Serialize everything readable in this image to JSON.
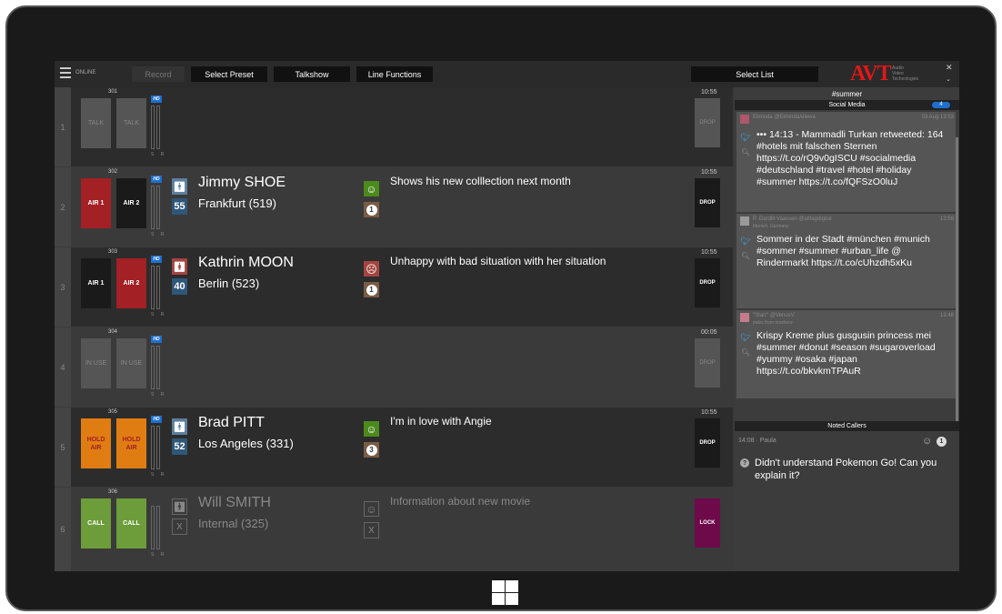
{
  "topbar": {
    "status": "ONLINE",
    "record": "Record",
    "buttons": [
      "Select Preset",
      "Talkshow",
      "Line Functions"
    ],
    "select_list": "Select List",
    "brand": "AVT",
    "brand_sub": [
      "Audio",
      "Video",
      "Technologies"
    ]
  },
  "lines": [
    {
      "num": "1",
      "ext": "301",
      "time": "10:55",
      "b1": "TALK",
      "b2": "TALK",
      "drop": "DROP"
    },
    {
      "num": "2",
      "ext": "302",
      "time": "10:55",
      "b1": "AIR 1",
      "b2": "AIR 2",
      "name": "Jimmy SHOE",
      "city": "Frankfurt (519)",
      "age": "55",
      "topic": "Shows his new colllection next month",
      "count": "1",
      "drop": "DROP"
    },
    {
      "num": "3",
      "ext": "303",
      "time": "10:55",
      "b1": "AIR 1",
      "b2": "AIR 2",
      "name": "Kathrin MOON",
      "city": "Berlin (523)",
      "age": "40",
      "topic": "Unhappy with bad situation with her situation",
      "count": "1",
      "drop": "DROP"
    },
    {
      "num": "4",
      "ext": "304",
      "time": "00:05",
      "b1": "IN USE",
      "b2": "IN USE",
      "drop": "DROP"
    },
    {
      "num": "5",
      "ext": "305",
      "time": "10:55",
      "b1": "HOLD AIR",
      "b2": "HOLD AIR",
      "name": "Brad PITT",
      "city": "Los Angeles (331)",
      "age": "52",
      "topic": "I'm in love with Angie",
      "count": "3",
      "drop": "DROP"
    },
    {
      "num": "6",
      "ext": "306",
      "b1": "CALL",
      "b2": "CALL",
      "name": "Will SMITH",
      "city": "Internal (325)",
      "age": "X",
      "topic": "Information about new movie",
      "count": "X",
      "drop": "LOCK"
    }
  ],
  "meter_label": "S R",
  "hd": "HD",
  "sidebar": {
    "hashtag": "#summer",
    "social_title": "Social Media",
    "social_count": "4",
    "tweets": [
      {
        "user": "Elminda  @ElmindaAliewa",
        "date": "03 Aug  13:53",
        "sub": "",
        "text": "••• 14:13 - Mammadli Turkan retweeted: 164 #hotels mit falschen Sternen https://t.co/rQ9v0gISCU #socialmedia #deutschland #travel #hotel #holiday #summer https://t.co/fQFSzO0luJ"
      },
      {
        "user": "P. Gardill-Vaassen  @alltagdigital",
        "date": "13:59",
        "sub": "Munich, Germany",
        "text": "Sommer in der Stadt #münchen #munich #sommer #summer #urban_life @ Rindermarkt https://t.co/cUhzdh5xKu"
      },
      {
        "user": "\"Starr\"  @VenusV",
        "date": "13:48",
        "sub": "miles from nowhere",
        "text": "Krispy Kreme plus gusgusin princess mei #summer #donut #season #sugaroverload #yummy #osaka #japan https://t.co/bkvkmTPAuR"
      }
    ],
    "noted_title": "Noted Callers",
    "noted_meta": "14:08 · Paula",
    "noted_count": "1",
    "noted_text": "Didn't understand Pokemon Go! Can you explain it?"
  },
  "colors": {
    "air_red": "#a32024",
    "hold": "#e07d12",
    "call": "#6d9d3a",
    "lock": "#6e0a4a",
    "happy": "#4c8a1d",
    "sad": "#a34540"
  }
}
